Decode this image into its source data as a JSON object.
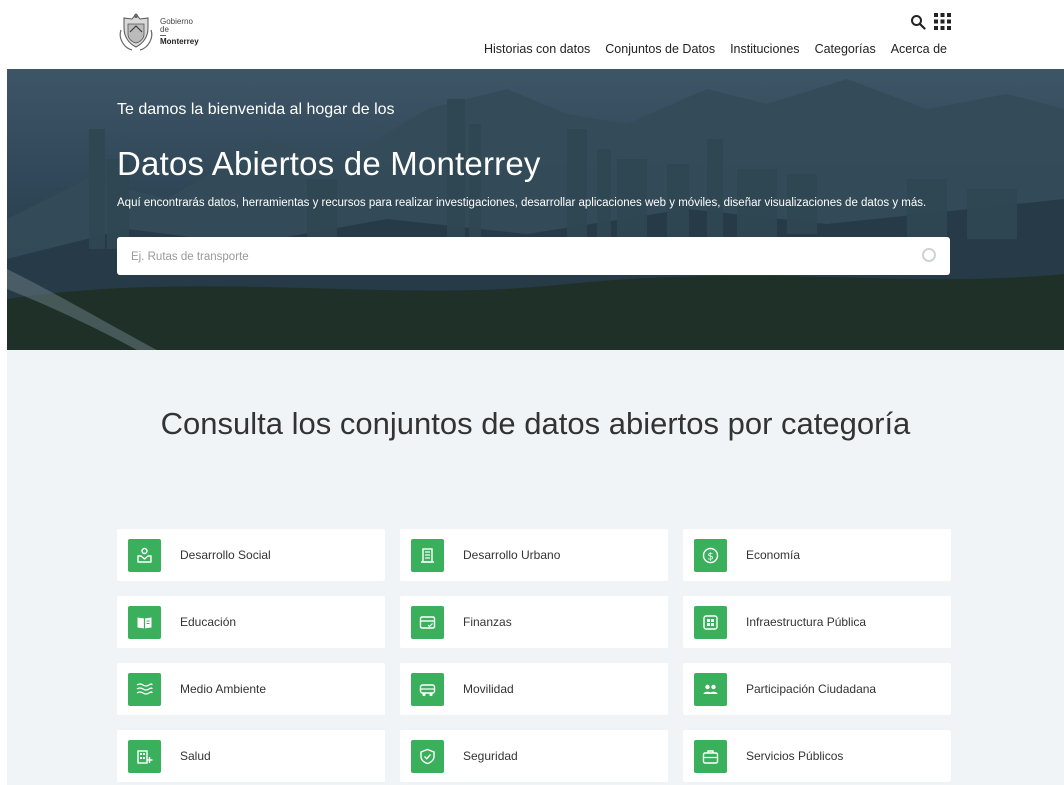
{
  "header": {
    "logo": {
      "line1": "Gobierno",
      "line2": "de",
      "line3": "Monterrey"
    },
    "nav": [
      "Historias con datos",
      "Conjuntos de Datos",
      "Instituciones",
      "Categorías",
      "Acerca de"
    ]
  },
  "hero": {
    "subtitle": "Te damos la bienvenida al hogar de los",
    "title": "Datos Abiertos de Monterrey",
    "description": "Aquí encontrarás datos, herramientas y recursos para realizar investigaciones, desarrollar aplicaciones web y móviles, diseñar visualizaciones de datos y más.",
    "search_placeholder": "Ej. Rutas de transporte"
  },
  "categories": {
    "title": "Consulta los conjuntos de datos abiertos por categoría",
    "accent": "#3aaf5c",
    "items": [
      {
        "label": "Desarrollo Social",
        "icon": "hand-heart-icon"
      },
      {
        "label": "Desarrollo Urbano",
        "icon": "building-icon"
      },
      {
        "label": "Economía",
        "icon": "dollar-icon"
      },
      {
        "label": "Educación",
        "icon": "book-icon"
      },
      {
        "label": "Finanzas",
        "icon": "card-icon"
      },
      {
        "label": "Infraestructura Pública",
        "icon": "grid-icon"
      },
      {
        "label": "Medio Ambiente",
        "icon": "waves-icon"
      },
      {
        "label": "Movilidad",
        "icon": "bus-icon"
      },
      {
        "label": "Participación Ciudadana",
        "icon": "people-icon"
      },
      {
        "label": "Salud",
        "icon": "hospital-icon"
      },
      {
        "label": "Seguridad",
        "icon": "shield-icon"
      },
      {
        "label": "Servicios Públicos",
        "icon": "briefcase-icon"
      }
    ]
  }
}
